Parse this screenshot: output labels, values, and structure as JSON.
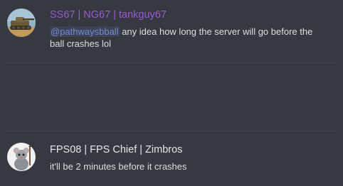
{
  "messages": [
    {
      "author": "SS67 | NG67 | tankguy67",
      "author_color": "#9b59d9",
      "avatar_icon": "tank-avatar",
      "mention": "@pathwaysbball",
      "text": " any idea how long the server will go before the ball crashes lol"
    },
    {
      "author": "FPS08 | FPS Chief | Zimbros",
      "author_color": "#e4e6e8",
      "avatar_icon": "rat-avatar",
      "text": "it'll be 2 minutes before it crashes"
    }
  ],
  "colors": {
    "background": "#36393f",
    "mention": "#7289da",
    "message_text": "#dcddde"
  }
}
